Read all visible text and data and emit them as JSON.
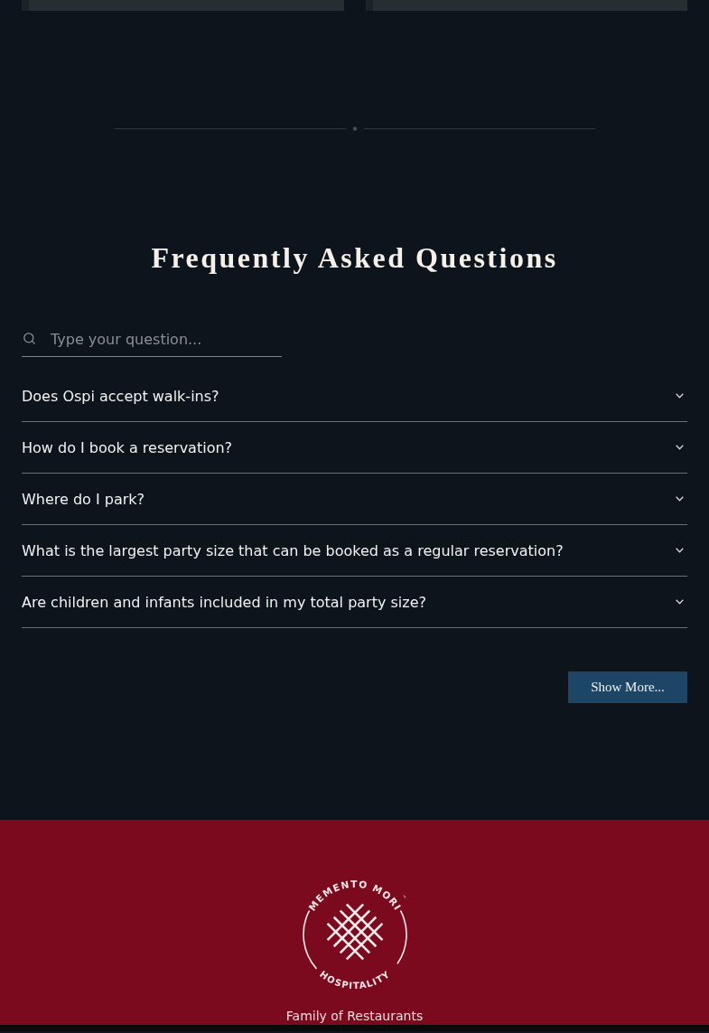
{
  "faq": {
    "title": "Frequently Asked Questions",
    "search": {
      "placeholder": "Type your question..."
    },
    "questions": [
      {
        "text": "Does Ospi accept walk-ins?",
        "expanded": false
      },
      {
        "text": "How do I book a reservation?",
        "expanded": false
      },
      {
        "text": "Where do I park?",
        "expanded": false
      },
      {
        "text": "What is the largest party size that can be booked as a regular reservation?",
        "expanded": false
      },
      {
        "text": "Are children and infants included in my total party size?",
        "expanded": false
      }
    ],
    "show_more": "Show More..."
  },
  "footer": {
    "logo": {
      "top_text": "MEMENTO MORI",
      "trademark": "™",
      "bottom_text": "HOSPITALITY"
    },
    "tagline": "Family of Restaurants"
  }
}
